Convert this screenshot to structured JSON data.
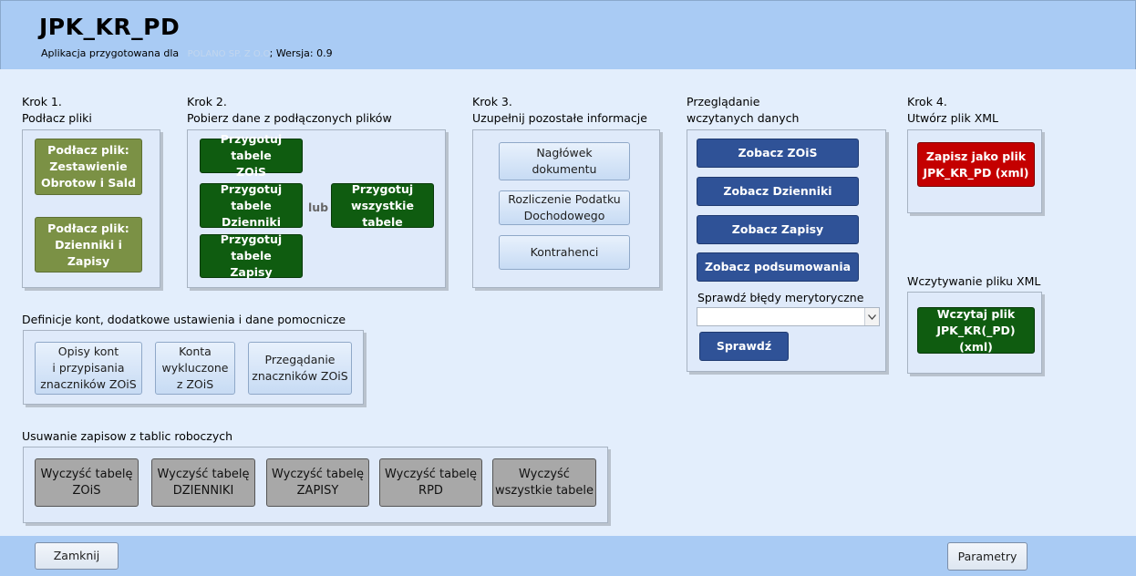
{
  "header": {
    "title": "JPK_KR_PD",
    "subtitle_prefix": "Aplikacja przygotowana dla",
    "company": "POLANO SP. Z O.O.",
    "subtitle_suffix": "; Wersja: 0.9"
  },
  "step1": {
    "heading": "Krok 1.",
    "subheading": "Podłacz pliki",
    "btn_zois": "Podłacz plik:\nZestawienie\nObrotow i Sald",
    "btn_dzienniki": "Podłacz plik:\nDzienniki i Zapisy"
  },
  "step2": {
    "heading": "Krok 2.",
    "subheading": "Pobierz dane z podłączonych plików",
    "btn_zois": "Przygotuj tabele\nZOiS",
    "btn_dzienniki": "Przygotuj tabele\nDzienniki",
    "btn_zapisy": "Przygotuj tabele\nZapisy",
    "or": "lub",
    "btn_all": "Przygotuj\nwszystkie tabele"
  },
  "step3": {
    "heading": "Krok 3.",
    "subheading": "Uzupełnij pozostałe informacje",
    "btn_naglowek": "Nagłówek\ndokumentu",
    "btn_rozliczenie": "Rozliczenie Podatku\nDochodowego",
    "btn_kontrahenci": "Kontrahenci"
  },
  "review": {
    "heading": "Przeglądanie",
    "subheading": "wczytanych danych",
    "btn_zois": "Zobacz ZOiS",
    "btn_dzienniki": "Zobacz Dzienniki",
    "btn_zapisy": "Zobacz Zapisy",
    "btn_podsumowania": "Zobacz podsumowania",
    "check_label": "Sprawdź błędy merytoryczne",
    "check_select_value": "",
    "btn_check": "Sprawdź"
  },
  "step4": {
    "heading": "Krok 4.",
    "subheading": "Utwórz plik XML",
    "btn_save": "Zapisz jako plik\nJPK_KR_PD (xml)"
  },
  "load_xml": {
    "heading": "Wczytywanie pliku XML",
    "btn_load": "Wczytaj plik\nJPK_KR(_PD) (xml)"
  },
  "definitions": {
    "heading": "Definicje kont, dodatkowe ustawienia i dane pomocnicze",
    "btn_opisy": "Opisy kont\ni przypisania\nznaczników ZOiS",
    "btn_konta": "Konta\nwykluczone\nz ZOiS",
    "btn_przegladanie": "Przegądanie\nznaczników ZOiS"
  },
  "cleanup": {
    "heading": "Usuwanie zapisow z tablic roboczych",
    "btn_zois": "Wyczyść tabelę\nZOiS",
    "btn_dzienniki": "Wyczyść tabelę\nDZIENNIKI",
    "btn_zapisy": "Wyczyść tabelę\nZAPISY",
    "btn_rpd": "Wyczyść tabelę\nRPD",
    "btn_all": "Wyczyść\nwszystkie tabele"
  },
  "footer": {
    "close": "Zamknij",
    "params": "Parametry"
  },
  "icons": {
    "dropdown": "chevron-down-icon"
  },
  "colors": {
    "header_bg": "#a9cbf4",
    "olive_button": "#7b9145",
    "green_button": "#0f5c10",
    "navy_button": "#2f5297",
    "red_button": "#c40000",
    "grey_button": "#a8a8a8"
  }
}
